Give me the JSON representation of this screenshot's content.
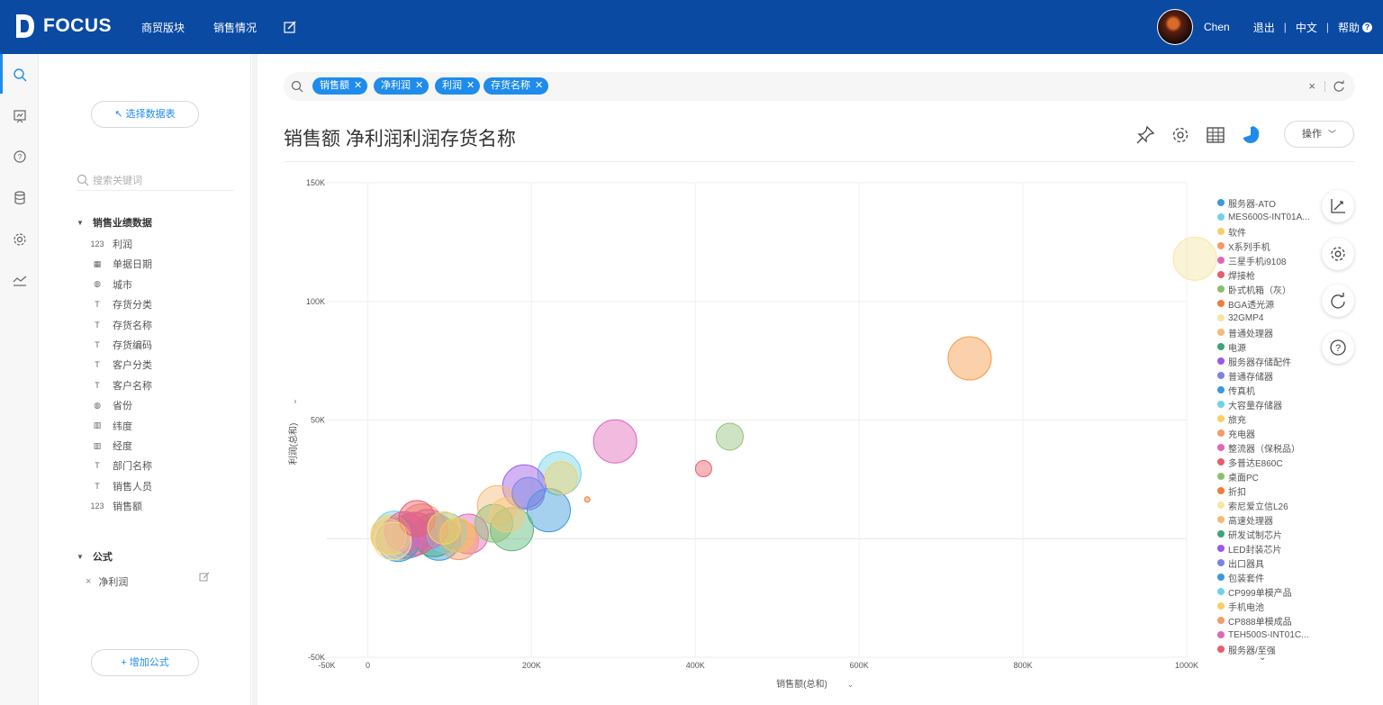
{
  "app": {
    "logo_text": "FOCUS"
  },
  "nav": {
    "items": [
      "商贸版块",
      "销售情况"
    ]
  },
  "user": {
    "name": "Chen",
    "logout": "退出",
    "language": "中文",
    "help": "帮助",
    "help_mark": "?"
  },
  "sidebar": {
    "select_table_label": "↖ 选择数据表",
    "search_placeholder": "搜索关键词",
    "group_title": "销售业绩数据",
    "fields": [
      {
        "icon": "number-icon",
        "glyph": "123",
        "label": "利润"
      },
      {
        "icon": "calendar-icon",
        "glyph": "▦",
        "label": "单据日期"
      },
      {
        "icon": "globe-icon",
        "glyph": "◍",
        "label": "城市"
      },
      {
        "icon": "text-icon",
        "glyph": "T",
        "label": "存货分类"
      },
      {
        "icon": "text-icon",
        "glyph": "T",
        "label": "存货名称"
      },
      {
        "icon": "text-icon",
        "glyph": "T",
        "label": "存货编码"
      },
      {
        "icon": "text-icon",
        "glyph": "T",
        "label": "客户分类"
      },
      {
        "icon": "text-icon",
        "glyph": "T",
        "label": "客户名称"
      },
      {
        "icon": "globe-icon",
        "glyph": "◍",
        "label": "省份"
      },
      {
        "icon": "map-icon",
        "glyph": "▥",
        "label": "纬度"
      },
      {
        "icon": "map-icon",
        "glyph": "▥",
        "label": "经度"
      },
      {
        "icon": "text-icon",
        "glyph": "T",
        "label": "部门名称"
      },
      {
        "icon": "text-icon",
        "glyph": "T",
        "label": "销售人员"
      },
      {
        "icon": "number-icon",
        "glyph": "123",
        "label": "销售额"
      }
    ],
    "formula_group_title": "公式",
    "formulas": [
      {
        "label": "净利润"
      }
    ],
    "add_formula_label": "+ 增加公式"
  },
  "search": {
    "tokens": [
      "销售额",
      "净利润",
      "利润",
      "存货名称"
    ],
    "clear": "×"
  },
  "page": {
    "title": "销售额 净利润利润存货名称",
    "operations_label": "操作"
  },
  "colors": {
    "brand": "#0a4aa3",
    "accent": "#1f8ceb"
  },
  "chart_data": {
    "type": "scatter",
    "bubble": true,
    "title": "",
    "xlabel": "销售额(总和)",
    "ylabel": "利润(总和)",
    "xlim": [
      -50000,
      1000000
    ],
    "ylim": [
      -50000,
      150000
    ],
    "x_ticks": [
      "-50K",
      "0",
      "200K",
      "400K",
      "600K",
      "800K",
      "1000K"
    ],
    "y_ticks": [
      "150K",
      "100K",
      "50K",
      "-50K"
    ],
    "grid": true,
    "legend_position": "right",
    "series": [
      {
        "name": "32GMP4",
        "color": "#f7e5a4",
        "points": [
          {
            "x": 1010000,
            "y": 118000,
            "r": 24
          }
        ]
      },
      {
        "name": "折扣",
        "color": "#f59a43",
        "points": [
          {
            "x": 735000,
            "y": 76000,
            "r": 24
          }
        ]
      },
      {
        "name": "桌面PC",
        "color": "#92c27a",
        "points": [
          {
            "x": 442000,
            "y": 43000,
            "r": 15
          }
        ]
      },
      {
        "name": "多普达E860C",
        "color": "#e85e6b",
        "points": [
          {
            "x": 410000,
            "y": 29500,
            "r": 9
          }
        ]
      },
      {
        "name": "整流器（保税品）",
        "color": "#e066b8",
        "points": [
          {
            "x": 302000,
            "y": 41000,
            "r": 24
          }
        ]
      },
      {
        "name": "BGA透光源",
        "color": "#f07c3a",
        "points": [
          {
            "x": 268000,
            "y": 16500,
            "r": 3
          }
        ]
      },
      {
        "name": "大容量存储器",
        "color": "#6ed3e8",
        "points": [
          {
            "x": 234000,
            "y": 27500,
            "r": 24
          }
        ]
      },
      {
        "name": "电源",
        "color": "#f7d063",
        "points": [
          {
            "x": 236000,
            "y": 25500,
            "r": 18
          }
        ]
      },
      {
        "name": "LED封装芯片",
        "color": "#9b59e8",
        "points": [
          {
            "x": 191000,
            "y": 22000,
            "r": 24
          }
        ]
      },
      {
        "name": "出口器具",
        "color": "#7b84e0",
        "points": [
          {
            "x": 196000,
            "y": 19000,
            "r": 18
          }
        ]
      },
      {
        "name": "传真机",
        "color": "#3a9ad9",
        "points": [
          {
            "x": 221000,
            "y": 12000,
            "r": 24
          }
        ]
      },
      {
        "name": "普通处理器",
        "color": "#f7b87a",
        "points": [
          {
            "x": 158000,
            "y": 14000,
            "r": 22
          }
        ]
      },
      {
        "name": "高速处理器",
        "color": "#f9c87a",
        "points": [
          {
            "x": 170000,
            "y": 10000,
            "r": 19
          }
        ]
      },
      {
        "name": "服务器存储配件",
        "color": "#5cb77a",
        "points": [
          {
            "x": 176000,
            "y": 4000,
            "r": 24
          }
        ]
      },
      {
        "name": "卧式机箱（灰）",
        "color": "#8cbf6e",
        "points": [
          {
            "x": 154000,
            "y": 6500,
            "r": 21
          }
        ]
      },
      {
        "name": "整流器（保税品）",
        "color": "#e066b8",
        "points": [
          {
            "x": 123000,
            "y": 2000,
            "r": 22
          }
        ]
      },
      {
        "name": "旅充",
        "color": "#f7c44f",
        "points": [
          {
            "x": 109000,
            "y": 1500,
            "r": 19
          }
        ]
      },
      {
        "name": "充电器",
        "color": "#f49a6b",
        "points": [
          {
            "x": 111000,
            "y": -500,
            "r": 22
          }
        ]
      },
      {
        "name": "服务器-ATO",
        "color": "#3a9ad9",
        "points": [
          {
            "x": 87000,
            "y": 0,
            "r": 24
          }
        ]
      },
      {
        "name": "MES600S-INT01A...",
        "color": "#6ed3e8",
        "points": [
          {
            "x": 96000,
            "y": 2500,
            "r": 22
          }
        ]
      },
      {
        "name": "软件",
        "color": "#f7d063",
        "points": [
          {
            "x": 93000,
            "y": 4500,
            "r": 18
          }
        ]
      },
      {
        "name": "X系列手机",
        "color": "#f49a6b",
        "points": [
          {
            "x": 66000,
            "y": 5500,
            "r": 24
          }
        ]
      },
      {
        "name": "三星手机i9108",
        "color": "#e066b8",
        "points": [
          {
            "x": 73000,
            "y": 4000,
            "r": 22
          }
        ]
      },
      {
        "name": "焊接枪",
        "color": "#e85e6b",
        "points": [
          {
            "x": 60000,
            "y": 8500,
            "r": 20
          }
        ]
      },
      {
        "name": "研发试制芯片",
        "color": "#3aa57a",
        "points": [
          {
            "x": 81000,
            "y": 1500,
            "r": 24
          }
        ]
      },
      {
        "name": "普通存储器",
        "color": "#7b84e0",
        "points": [
          {
            "x": 49000,
            "y": 1000,
            "r": 24
          }
        ]
      },
      {
        "name": "CP999单模产品",
        "color": "#6ed3e8",
        "points": [
          {
            "x": 33000,
            "y": 2500,
            "r": 24
          }
        ]
      },
      {
        "name": "手机电池",
        "color": "#f7d063",
        "points": [
          {
            "x": 28000,
            "y": 1500,
            "r": 22
          }
        ]
      },
      {
        "name": "CP888单模成品",
        "color": "#f49a6b",
        "points": [
          {
            "x": 40000,
            "y": 500,
            "r": 24
          }
        ]
      },
      {
        "name": "TEH500S-INT01C...",
        "color": "#e066b8",
        "points": [
          {
            "x": 45000,
            "y": 3000,
            "r": 22
          }
        ]
      },
      {
        "name": "服务器/至强",
        "color": "#e85e6b",
        "points": [
          {
            "x": 57000,
            "y": 2000,
            "r": 24
          }
        ]
      },
      {
        "name": "包装套件",
        "color": "#3a9ad9",
        "points": [
          {
            "x": 37000,
            "y": -500,
            "r": 24
          }
        ]
      },
      {
        "name": "索尼爱立信L26",
        "color": "#f7e5a4",
        "points": [
          {
            "x": 30000,
            "y": -1000,
            "r": 21
          }
        ]
      },
      {
        "name": "高速处理器",
        "color": "#f9c87a",
        "points": [
          {
            "x": 26000,
            "y": 1000,
            "r": 19
          }
        ]
      }
    ]
  },
  "legend": {
    "items": [
      {
        "label": "服务器-ATO",
        "color": "#3a9ad9"
      },
      {
        "label": "MES600S-INT01A...",
        "color": "#6ed3e8"
      },
      {
        "label": "软件",
        "color": "#f7d063"
      },
      {
        "label": "X系列手机",
        "color": "#f49a6b"
      },
      {
        "label": "三星手机i9108",
        "color": "#e066b8"
      },
      {
        "label": "焊接枪",
        "color": "#e85e6b"
      },
      {
        "label": "卧式机箱（灰）",
        "color": "#8cbf6e"
      },
      {
        "label": "BGA透光源",
        "color": "#f07c3a"
      },
      {
        "label": "32GMP4",
        "color": "#f7e5a4"
      },
      {
        "label": "普通处理器",
        "color": "#f7b87a"
      },
      {
        "label": "电源",
        "color": "#3aa57a"
      },
      {
        "label": "服务器存储配件",
        "color": "#9b59e8"
      },
      {
        "label": "普通存储器",
        "color": "#7b84e0"
      },
      {
        "label": "传真机",
        "color": "#3a9ad9"
      },
      {
        "label": "大容量存储器",
        "color": "#6ed3e8"
      },
      {
        "label": "旅充",
        "color": "#f7d063"
      },
      {
        "label": "充电器",
        "color": "#f49a6b"
      },
      {
        "label": "整流器（保税品）",
        "color": "#e066b8"
      },
      {
        "label": "多普达E860C",
        "color": "#e85e6b"
      },
      {
        "label": "桌面PC",
        "color": "#8cbf6e"
      },
      {
        "label": "折扣",
        "color": "#f07c3a"
      },
      {
        "label": "索尼爱立信L26",
        "color": "#f7e5a4"
      },
      {
        "label": "高速处理器",
        "color": "#f7b87a"
      },
      {
        "label": "研发试制芯片",
        "color": "#3aa57a"
      },
      {
        "label": "LED封装芯片",
        "color": "#9b59e8"
      },
      {
        "label": "出口器具",
        "color": "#7b84e0"
      },
      {
        "label": "包装套件",
        "color": "#3a9ad9"
      },
      {
        "label": "CP999单模产品",
        "color": "#6ed3e8"
      },
      {
        "label": "手机电池",
        "color": "#f7d063"
      },
      {
        "label": "CP888单模成品",
        "color": "#f49a6b"
      },
      {
        "label": "TEH500S-INT01C...",
        "color": "#e066b8"
      },
      {
        "label": "服务器/至强",
        "color": "#e85e6b"
      }
    ],
    "more_glyph": "⌄"
  }
}
